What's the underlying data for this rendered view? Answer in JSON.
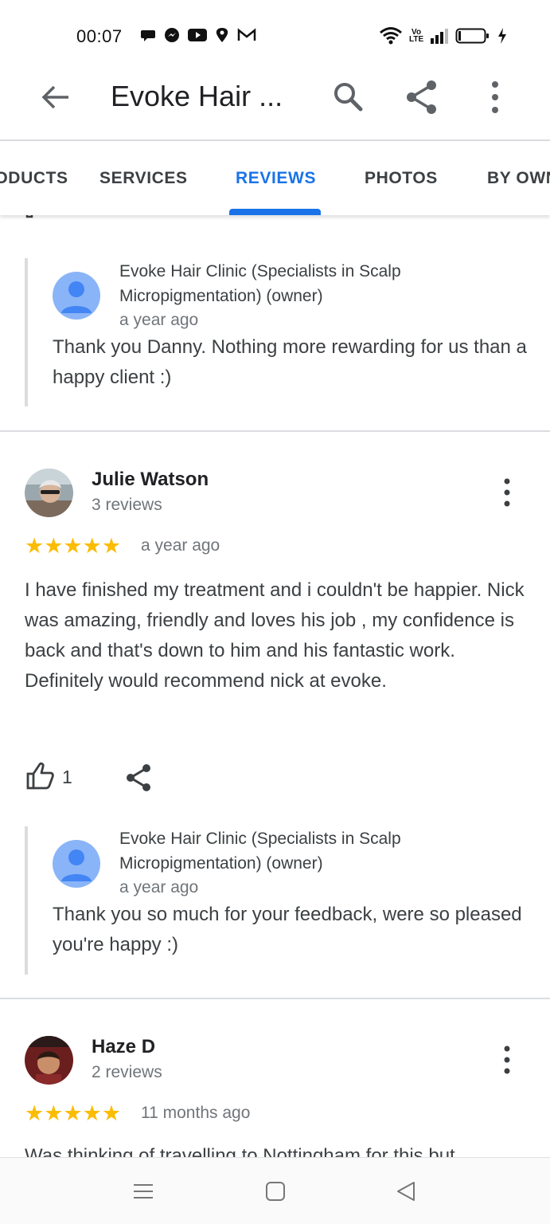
{
  "status_bar": {
    "time": "00:07",
    "left_icons": [
      "chat-bubble-icon",
      "messenger-icon",
      "youtube-icon",
      "swiggy-icon",
      "gmail-icon"
    ],
    "right_icons": [
      "wifi-icon",
      "volte-icon",
      "signal-icon",
      "battery-icon",
      "charging-icon"
    ],
    "volte_label_top": "Vo",
    "volte_label_bottom": "LTE"
  },
  "app_bar": {
    "title": "Evoke Hair ...",
    "back_icon": "arrow-back-icon",
    "search_icon": "search-icon",
    "share_icon": "share-icon",
    "more_icon": "more-vert-icon"
  },
  "tabs": [
    {
      "label": "PRODUCTS",
      "active": false
    },
    {
      "label": "SERVICES",
      "active": false
    },
    {
      "label": "REVIEWS",
      "active": true
    },
    {
      "label": "PHOTOS",
      "active": false
    },
    {
      "label": "BY OWNER",
      "active": false
    }
  ],
  "colors": {
    "accent": "#1a73e8",
    "star": "#fbbc04",
    "divider": "#dadce0",
    "owner_avatar": "#8ab4f8",
    "owner_avatar_figure": "#4285f4"
  },
  "reply_1": {
    "owner_name": "Evoke Hair Clinic (Specialists in Scalp Micropigmentation) (owner)",
    "date": "a year ago",
    "text": "Thank you Danny. Nothing more rewarding for us than a happy client :)"
  },
  "review_julie": {
    "name": "Julie Watson",
    "count": "3 reviews",
    "rating": 5,
    "stars": "★★★★★",
    "date": "a year ago",
    "text": "I have finished my treatment and i couldn't be happier. Nick was amazing, friendly and loves his job , my confidence is back and that's down to him and his fantastic work. Definitely would recommend nick at evoke.",
    "likes": "1",
    "reply": {
      "owner_name": "Evoke Hair Clinic (Specialists in Scalp Micropigmentation) (owner)",
      "date": "a year ago",
      "text": "Thank you so much for your feedback, were so pleased you're happy :)"
    }
  },
  "review_haze": {
    "name": "Haze D",
    "count": "2 reviews",
    "rating": 5,
    "stars": "★★★★★",
    "date": "11 months ago",
    "text_partial": "Was thinking of travelling to Nottingham for this but"
  },
  "nav_bar": {
    "icons": [
      "menu-icon",
      "home-square-icon",
      "back-triangle-icon"
    ]
  }
}
